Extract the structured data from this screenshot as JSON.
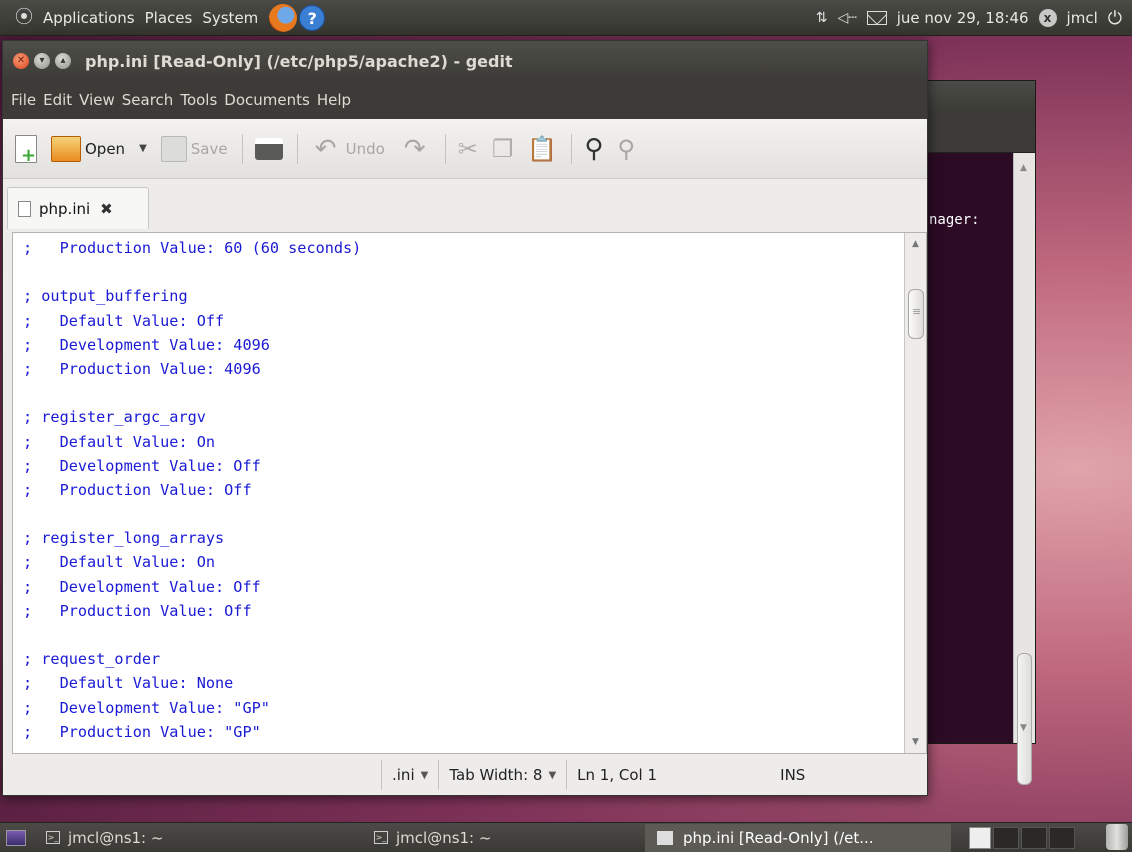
{
  "top_panel": {
    "menus": [
      "Applications",
      "Places",
      "System"
    ],
    "clock": "jue nov 29, 18:46",
    "user": "jmcl"
  },
  "terminal_bg": {
    "visible_text": "nager:"
  },
  "window": {
    "title": "php.ini [Read-Only] (/etc/php5/apache2) - gedit",
    "menus": [
      "File",
      "Edit",
      "View",
      "Search",
      "Tools",
      "Documents",
      "Help"
    ],
    "toolbar": {
      "open_label": "Open",
      "save_label": "Save",
      "undo_label": "Undo"
    },
    "tab": {
      "label": "php.ini"
    },
    "code_lines": [
      ";   Production Value: 60 (60 seconds)",
      "",
      "; output_buffering",
      ";   Default Value: Off",
      ";   Development Value: 4096",
      ";   Production Value: 4096",
      "",
      "; register_argc_argv",
      ";   Default Value: On",
      ";   Development Value: Off",
      ";   Production Value: Off",
      "",
      "; register_long_arrays",
      ";   Default Value: On",
      ";   Development Value: Off",
      ";   Production Value: Off",
      "",
      "; request_order",
      ";   Default Value: None",
      ";   Development Value: \"GP\"",
      ";   Production Value: \"GP\""
    ],
    "statusbar": {
      "language": ".ini",
      "tab_width": "Tab Width: 8",
      "position": "Ln 1, Col 1",
      "mode": "INS"
    }
  },
  "taskbar": {
    "tasks": [
      {
        "label": "jmcl@ns1: ~"
      },
      {
        "label": "jmcl@ns1: ~"
      },
      {
        "label": "php.ini [Read-Only] (/et..."
      }
    ]
  },
  "colors": {
    "code_text": "#1a1ad6",
    "panel": "#3c3b37",
    "desktop": "#c0697e"
  }
}
